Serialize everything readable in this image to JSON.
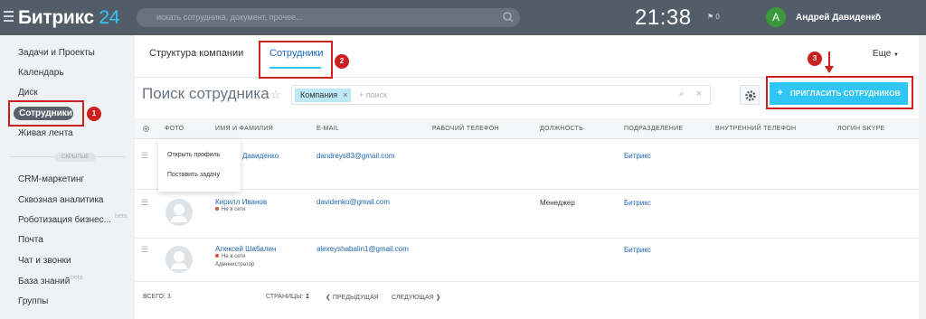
{
  "topbar": {
    "logo_main": "Битрикс",
    "logo_accent": "24",
    "search_placeholder": "искать сотрудника, документ, прочее...",
    "clock": "21:38",
    "flag_count": "0",
    "user_initial": "А",
    "user_name": "Андрей Давиденко"
  },
  "sidebar": {
    "items": [
      "Задачи и Проекты",
      "Календарь",
      "Диск",
      "Сотрудники",
      "Живая лента",
      "CRM-маркетинг",
      "Сквозная аналитика",
      "Роботизация бизнес...",
      "Почта",
      "Чат и звонки",
      "База знаний",
      "Группы"
    ],
    "hidden_label": "СКРЫТЫЕ",
    "beta_label": "beta"
  },
  "tabs": {
    "structure": "Структура компании",
    "employees": "Сотрудники",
    "more": "Еще"
  },
  "toolbar": {
    "title": "Поиск сотрудника",
    "filter_chip": "Компания",
    "filter_placeholder": "+ поиск",
    "invite_button": "ПРИГЛАСИТЬ СОТРУДНИКОВ"
  },
  "table": {
    "headers": [
      "ФОТО",
      "ИМЯ И ФАМИЛИЯ",
      "E-MAIL",
      "РАБОЧИЙ ТЕЛЕФОН",
      "ДОЛЖНОСТЬ",
      "ПОДРАЗДЕЛЕНИЕ",
      "ВНУТРЕННИЙ ТЕЛЕФОН",
      "ЛОГИН SKYPE"
    ],
    "rows": [
      {
        "name": "Давиденко",
        "status": "",
        "role": "",
        "email": "dandreys83@gmail.com",
        "position": "",
        "department": "Битрикс"
      },
      {
        "name": "Кирилл Иванов",
        "status": "Не в сети",
        "role": "",
        "email": "davidenko@gmail.com",
        "position": "Менеджер",
        "department": "Битрикс"
      },
      {
        "name": "Алексей Шабалин",
        "status": "Не в сети",
        "role": "Администратор",
        "email": "alexeyshabalin1@gmail.com",
        "position": "",
        "department": "Битрикс"
      }
    ]
  },
  "context_menu": {
    "open_profile": "Открыть профиль",
    "set_task": "Поставить задачу"
  },
  "footer": {
    "total": "ВСЕГО: 3",
    "pages_label": "СТРАНИЦЫ:",
    "page": "1",
    "prev": "ПРЕДЫДУЩАЯ",
    "next": "СЛЕДУЮЩАЯ"
  },
  "annotations": {
    "one": "1",
    "two": "2",
    "three": "3"
  },
  "colors": {
    "accent": "#2fc6f6",
    "topbar": "#535c69",
    "annotation": "#cc1f1f",
    "link": "#2067b0"
  }
}
